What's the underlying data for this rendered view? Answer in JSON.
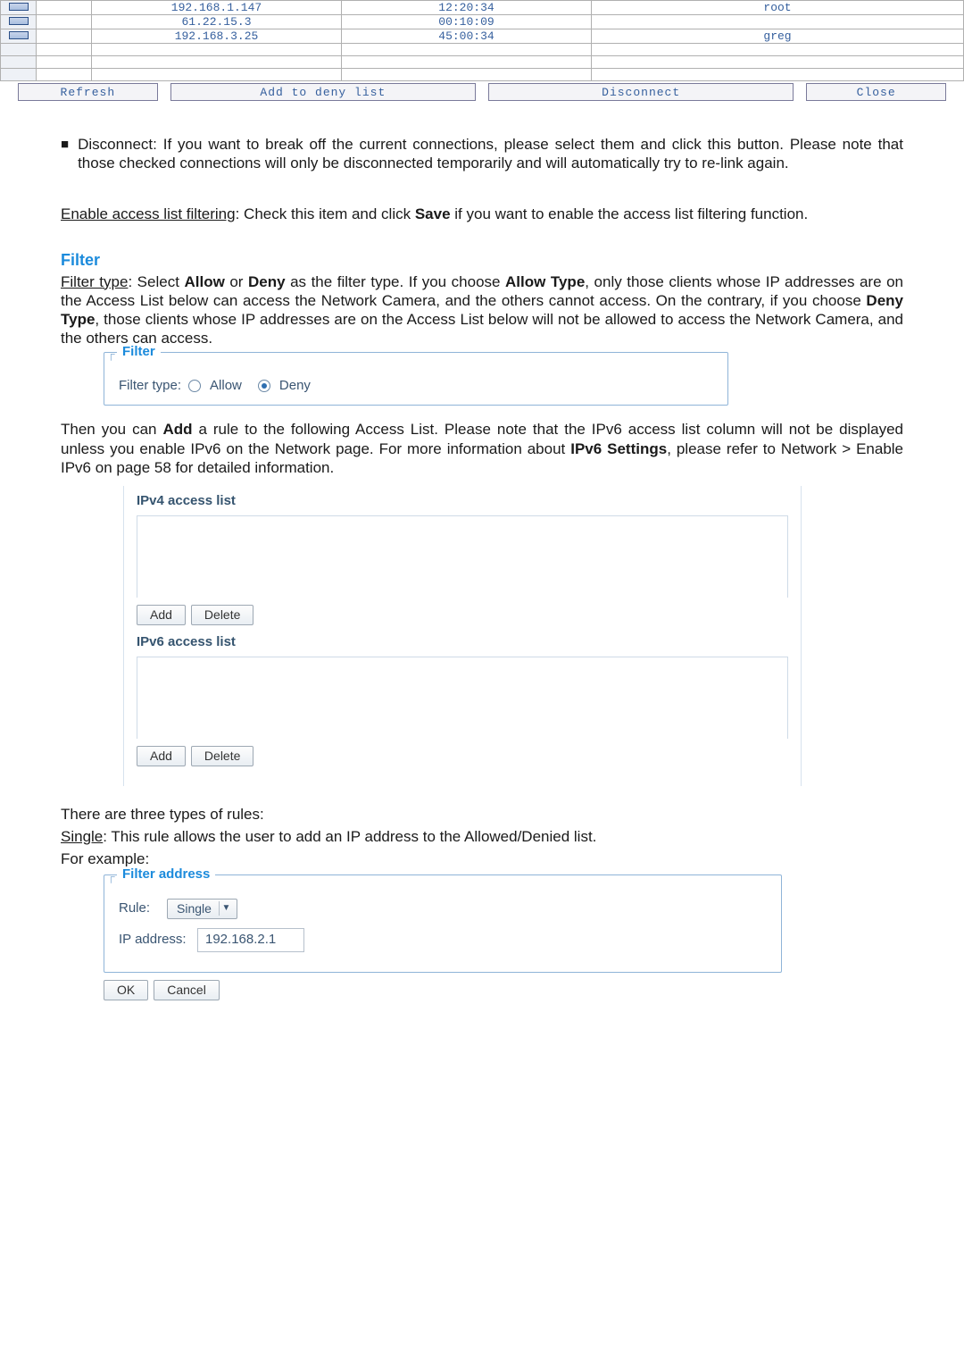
{
  "conn_table": {
    "rows": [
      {
        "chk": true,
        "id": "",
        "ip": "192.168.1.147",
        "time": "12:20:34",
        "user": "root"
      },
      {
        "chk": true,
        "id": "",
        "ip": "61.22.15.3",
        "time": "00:10:09",
        "user": ""
      },
      {
        "chk": true,
        "id": "",
        "ip": "192.168.3.25",
        "time": "45:00:34",
        "user": "greg"
      },
      {
        "chk": false,
        "id": "",
        "ip": "",
        "time": "",
        "user": ""
      },
      {
        "chk": false,
        "id": "",
        "ip": "",
        "time": "",
        "user": ""
      },
      {
        "chk": false,
        "id": "",
        "ip": "",
        "time": "",
        "user": ""
      }
    ],
    "buttons": {
      "refresh": "Refresh",
      "add_deny": "Add to deny list",
      "disconnect": "Disconnect",
      "close": "Close"
    }
  },
  "disconnect_bullet": "Disconnect: If you want to break off the current connections, please select them and click this button. Please note that those checked connections will only be disconnected temporarily and will automatically try to re-link again.",
  "enable_access_label": "Enable access list filtering",
  "enable_access_text_pre": ": Check this item and click ",
  "enable_access_text_bold": "Save",
  "enable_access_text_post": " if you want to enable the access list filtering function.",
  "filter_heading": "Filter",
  "filter_type_label": "Filter type",
  "filter_type_body_1": ": Select ",
  "filter_type_allow_b": "Allow",
  "filter_type_body_2": " or ",
  "filter_type_deny_b": "Deny",
  "filter_type_body_3": " as the filter type. If you choose ",
  "filter_type_allowtype_b": "Allow Type",
  "filter_type_body_4": ", only those clients whose IP addresses are on the Access List below can access the Network Camera, and the others cannot access. On the contrary, if you choose ",
  "filter_type_denytype_b": "Deny Type",
  "filter_type_body_5": ", those clients whose IP addresses are on the Access List below will not be allowed to access the Network Camera, and the others can access.",
  "filter_panel": {
    "legend": "Filter",
    "label": "Filter type:",
    "allow": "Allow",
    "deny": "Deny"
  },
  "add_rule_text_1": "Then you can ",
  "add_rule_bold_add": "Add",
  "add_rule_text_2": " a rule to the following Access List. Please note that the IPv6 access list column will not be displayed unless you enable IPv6 on the Network page. For more information about ",
  "add_rule_bold_ipv6": "IPv6 Settings",
  "add_rule_text_3": ", please refer to Network > Enable IPv6 on page 58 for detailed information.",
  "access_list": {
    "ipv4_title": "IPv4 access list",
    "ipv6_title": "IPv6 access list",
    "add": "Add",
    "del": "Delete"
  },
  "rule_intro": "There are three types of rules:",
  "rule_single_lbl": "Single",
  "rule_single_text": ": This rule allows the user to add an IP address to the Allowed/Denied list.",
  "rule_example": "For example:",
  "filter_address": {
    "legend": "Filter address",
    "rule_label": "Rule:",
    "rule_value": "Single",
    "ip_label": "IP address:",
    "ip_value": "192.168.2.1"
  },
  "ok_cancel": {
    "ok": "OK",
    "cancel": "Cancel"
  }
}
